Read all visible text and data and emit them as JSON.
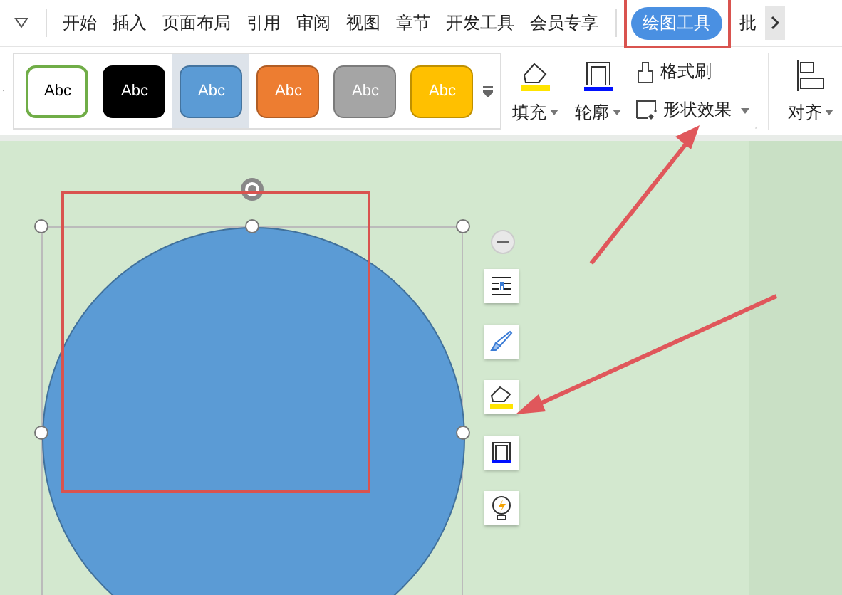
{
  "tabs": [
    {
      "label": "开始",
      "selected": false
    },
    {
      "label": "插入",
      "selected": false
    },
    {
      "label": "页面布局",
      "selected": false
    },
    {
      "label": "引用",
      "selected": false
    },
    {
      "label": "审阅",
      "selected": false
    },
    {
      "label": "视图",
      "selected": false
    },
    {
      "label": "章节",
      "selected": false
    },
    {
      "label": "开发工具",
      "selected": false
    },
    {
      "label": "会员专享",
      "selected": false
    },
    {
      "label": "绘图工具",
      "selected": true
    },
    {
      "label": "批",
      "selected": false
    }
  ],
  "style_gallery": [
    {
      "label": "Abc",
      "kind": "outline",
      "color": "#70ad47",
      "selected": false
    },
    {
      "label": "Abc",
      "kind": "filled",
      "color": "#000000",
      "selected": false
    },
    {
      "label": "Abc",
      "kind": "filled",
      "color": "#5b9bd5",
      "selected": true
    },
    {
      "label": "Abc",
      "kind": "filled",
      "color": "#ed7d31",
      "selected": false
    },
    {
      "label": "Abc",
      "kind": "filled",
      "color": "#a5a5a5",
      "selected": false
    },
    {
      "label": "Abc",
      "kind": "filled",
      "color": "#ffc000",
      "selected": false
    }
  ],
  "ribbon_buttons": {
    "fill": "填充",
    "outline": "轮廓",
    "format_painter": "格式刷",
    "shape_effects": "形状效果",
    "align": "对齐"
  },
  "float_toolbar": [
    {
      "kind": "wrap"
    },
    {
      "kind": "style"
    },
    {
      "kind": "fill"
    },
    {
      "kind": "outline"
    },
    {
      "kind": "effects"
    }
  ]
}
